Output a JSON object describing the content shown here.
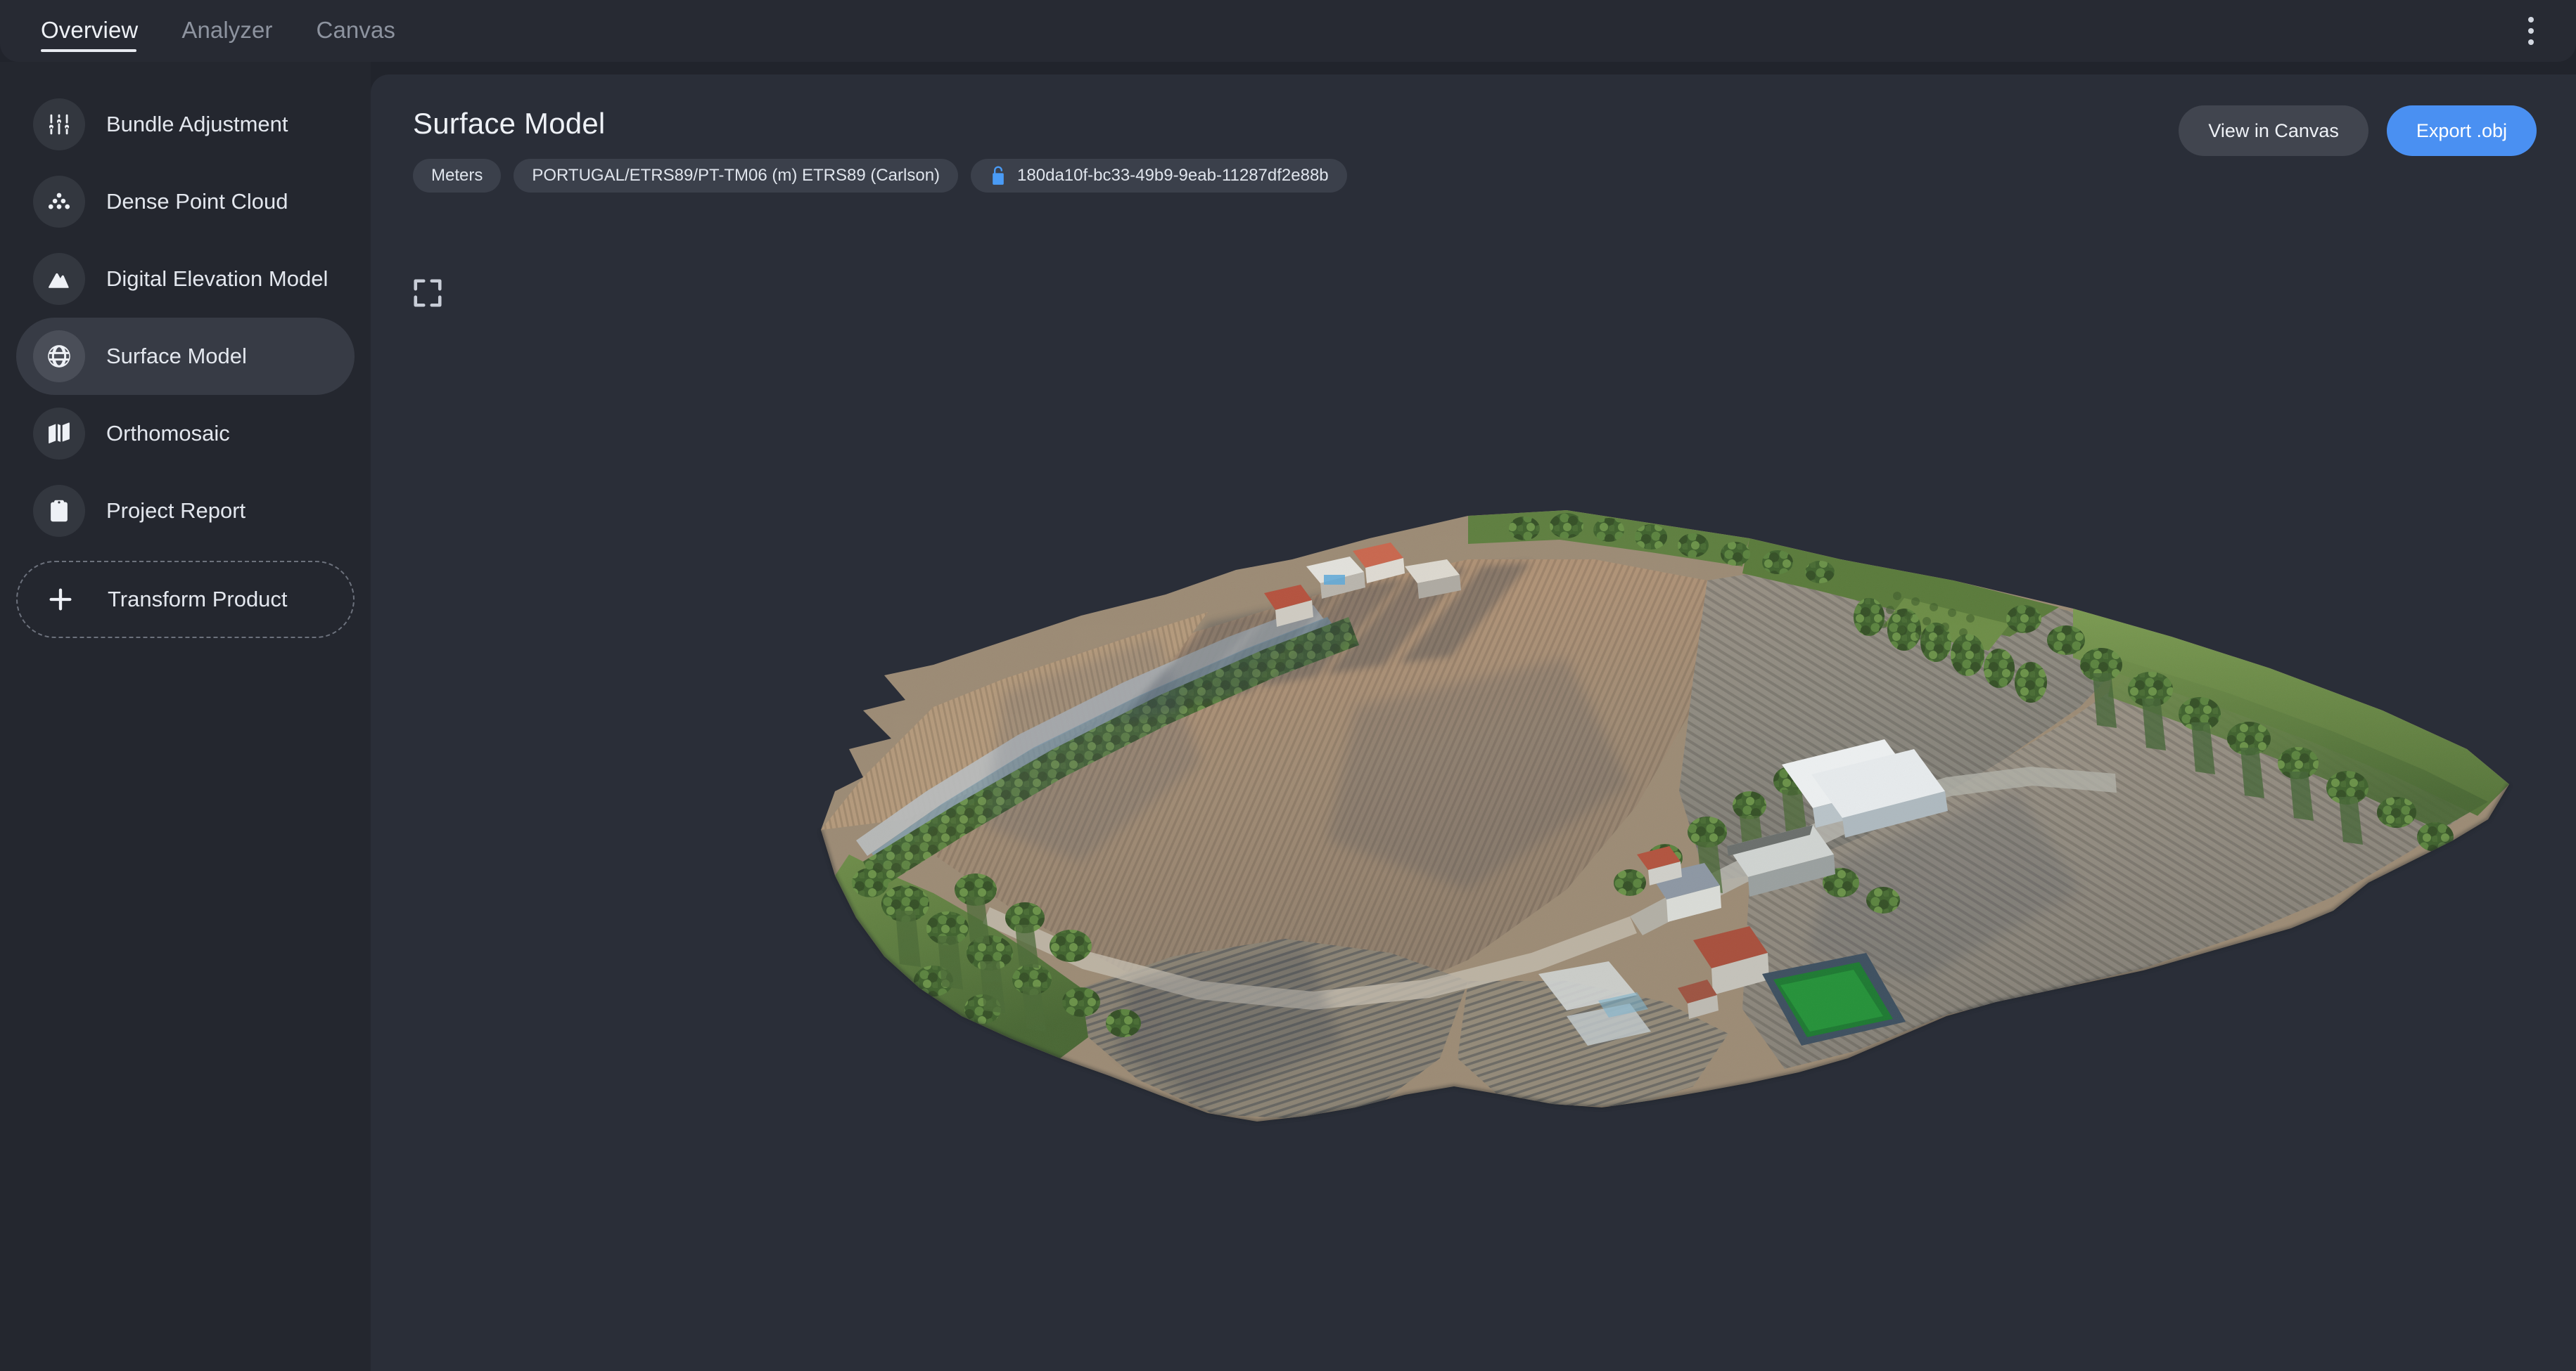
{
  "topbar": {
    "tabs": [
      {
        "label": "Overview",
        "active": true
      },
      {
        "label": "Analyzer",
        "active": false
      },
      {
        "label": "Canvas",
        "active": false
      }
    ],
    "menu_icon": "kebab-menu-icon"
  },
  "sidebar": {
    "items": [
      {
        "label": "Bundle Adjustment",
        "icon": "sliders-icon",
        "active": false
      },
      {
        "label": "Dense Point Cloud",
        "icon": "points-cluster-icon",
        "active": false
      },
      {
        "label": "Digital Elevation Model",
        "icon": "mountain-icon",
        "active": false
      },
      {
        "label": "Surface Model",
        "icon": "globe-icon",
        "active": true
      },
      {
        "label": "Orthomosaic",
        "icon": "map-icon",
        "active": false
      },
      {
        "label": "Project Report",
        "icon": "clipboard-check-icon",
        "active": false
      }
    ],
    "transform_product": {
      "label": "Transform Product",
      "icon": "plus-icon"
    }
  },
  "main": {
    "title": "Surface Model",
    "chips": [
      {
        "label": "Meters",
        "icon": null
      },
      {
        "label": "PORTUGAL/ETRS89/PT-TM06 (m) ETRS89 (Carlson)",
        "icon": null
      },
      {
        "label": "180da10f-bc33-49b9-9eab-11287df2e88b",
        "icon": "unlock-icon"
      }
    ],
    "actions": {
      "view_in_canvas": "View in Canvas",
      "export_obj": "Export .obj"
    },
    "expand_icon": "fullscreen-expand-icon"
  },
  "colors": {
    "accent": "#4a90f2",
    "lock_blue": "#4a9bf5",
    "page_bg": "#21242c",
    "panel_bg": "#2a2e38",
    "sidebar_bg": "#24272f",
    "topbar_bg": "#272a33"
  }
}
